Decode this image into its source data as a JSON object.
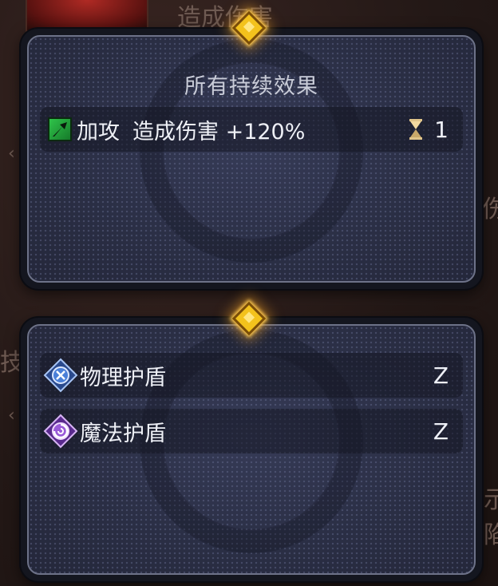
{
  "background": {
    "top_text": "造成伤害",
    "left_text": "技",
    "right_text_1": "伤",
    "right_text_2": "示",
    "right_text_3": "陷",
    "chevron": "‹"
  },
  "effects_panel": {
    "title": "所有持续效果",
    "effects": [
      {
        "icon": "attack-up-icon",
        "name": "加攻",
        "description": "造成伤害 +120%",
        "duration_icon": "hourglass-icon",
        "duration": "1"
      }
    ]
  },
  "shields_panel": {
    "shields": [
      {
        "icon": "physical-shield-icon",
        "name": "物理护盾",
        "value": "Z"
      },
      {
        "icon": "magic-shield-icon",
        "name": "魔法护盾",
        "value": "Z"
      }
    ]
  },
  "colors": {
    "gem": "#f3c21c",
    "panel_border": "#6d7288",
    "physical_shield": "#4a7fd8",
    "magic_shield": "#9a5ad8",
    "buff_green": "#2fc44a"
  }
}
